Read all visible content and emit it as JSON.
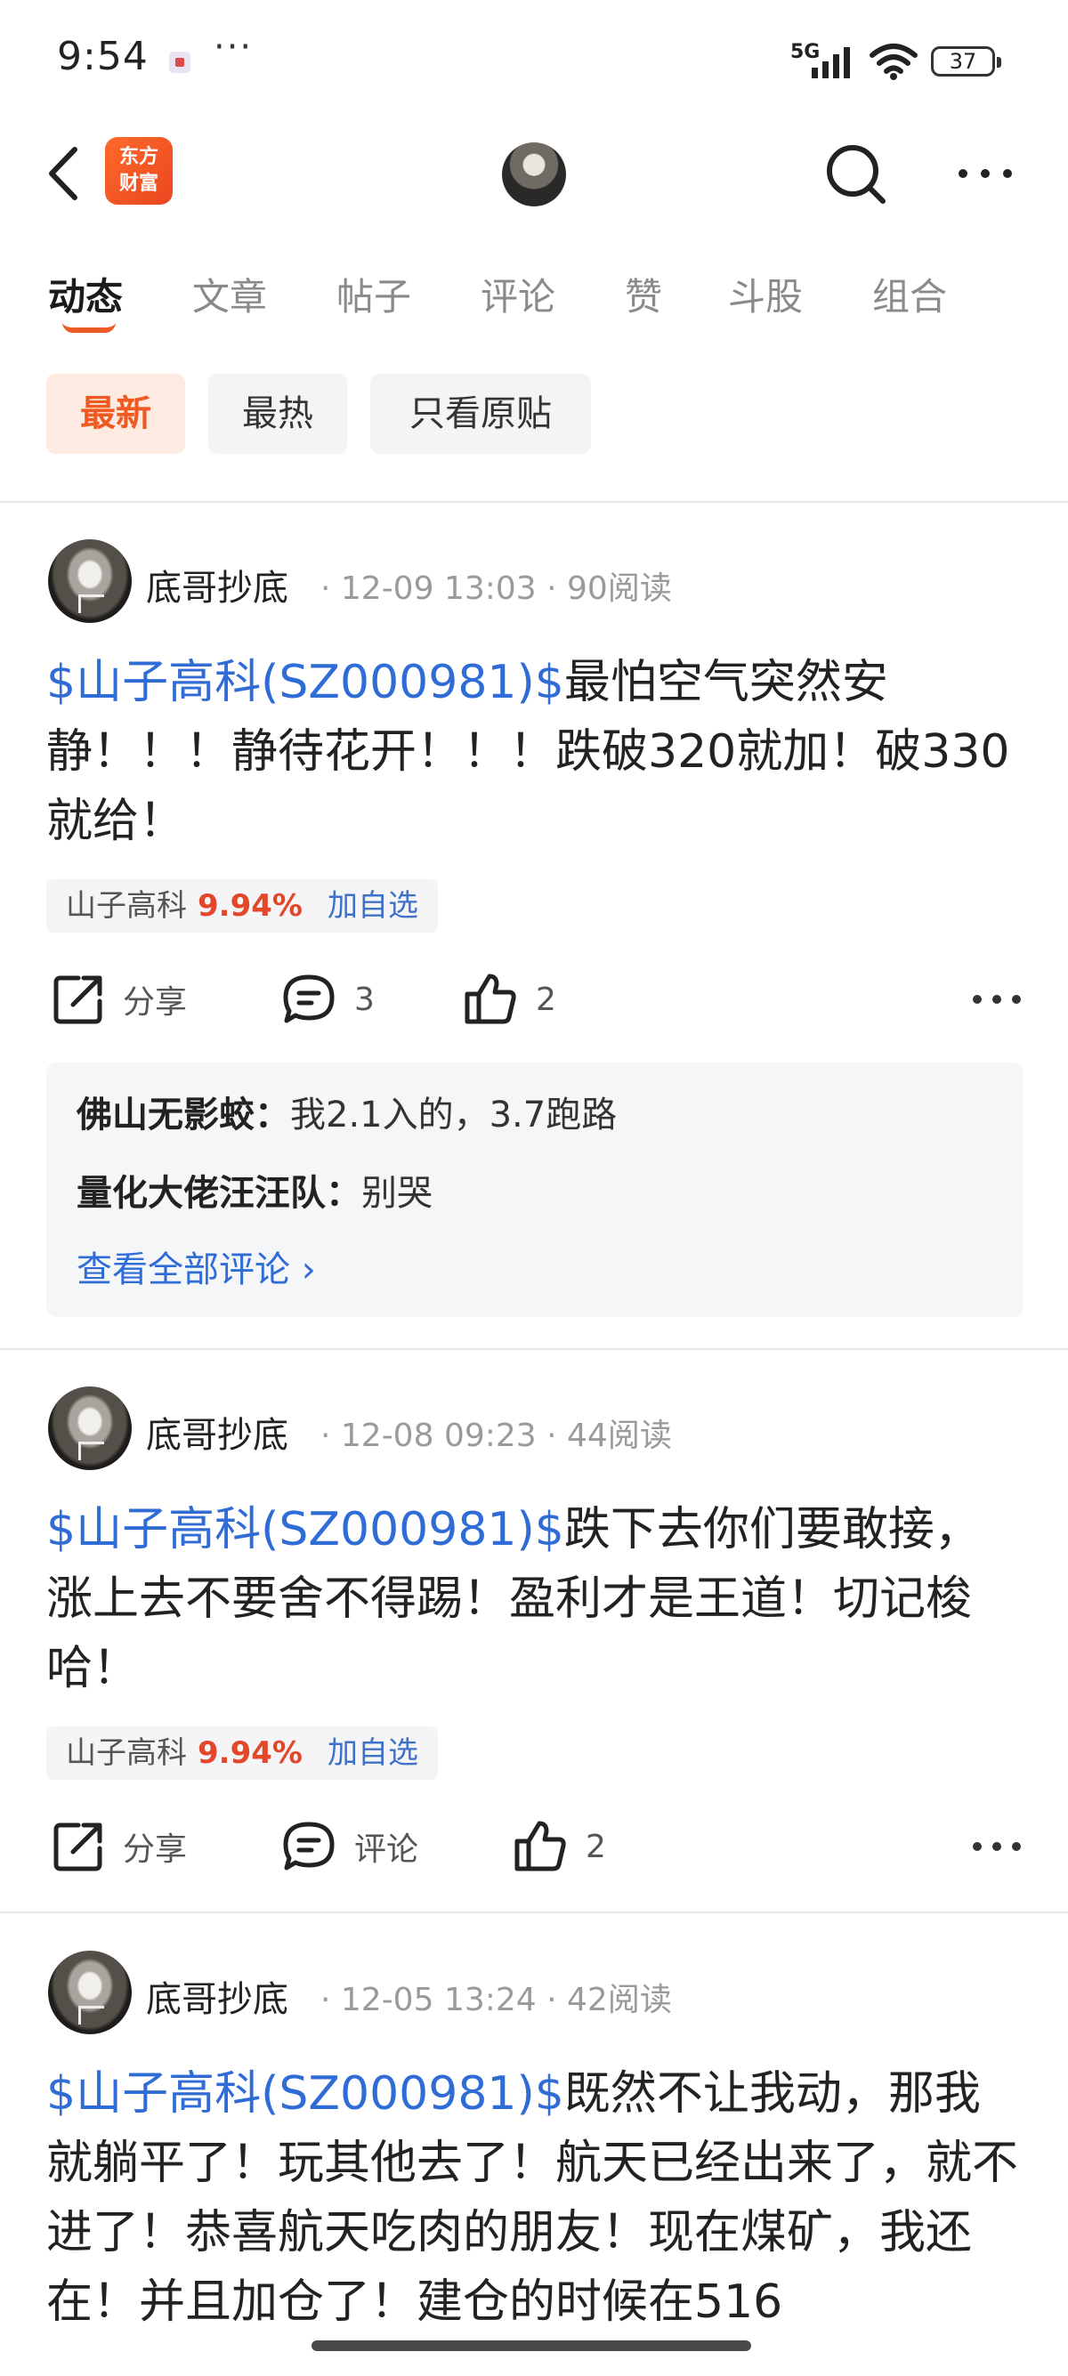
{
  "status_bar": {
    "time": "9:54",
    "dots": "···",
    "network": "5G",
    "battery": "37"
  },
  "nav": {
    "brand": "东方财富",
    "brand_line1": "东方",
    "brand_line2": "财富"
  },
  "tabs": [
    {
      "label": "动态",
      "active": true
    },
    {
      "label": "文章"
    },
    {
      "label": "帖子"
    },
    {
      "label": "评论"
    },
    {
      "label": "赞"
    },
    {
      "label": "斗股"
    },
    {
      "label": "组合"
    }
  ],
  "filters": [
    {
      "label": "最新",
      "active": true
    },
    {
      "label": "最热"
    },
    {
      "label": "只看原贴"
    }
  ],
  "posts": [
    {
      "author": "底哥抄底",
      "meta": "· 12-09 13:03 · 90阅读",
      "stock_link": "$山子高科(SZ000981)$",
      "text": "最怕空气突然安静！！！静待花开！！！跌破320就加！破330就给！",
      "tag": {
        "name": "山子高科",
        "pct": "9.94%",
        "add": "加自选"
      },
      "share": "分享",
      "comment": "3",
      "like": "2",
      "comments": [
        {
          "user": "佛山无影蛟：",
          "text": "我2.1入的，3.7跑路"
        },
        {
          "user": "量化大佬汪汪队：",
          "text": "别哭"
        }
      ],
      "view_all": "查看全部评论 ›"
    },
    {
      "author": "底哥抄底",
      "meta": "· 12-08 09:23 · 44阅读",
      "stock_link": "$山子高科(SZ000981)$",
      "text": "跌下去你们要敢接，涨上去不要舍不得踢！盈利才是王道！切记梭哈！",
      "tag": {
        "name": "山子高科",
        "pct": "9.94%",
        "add": "加自选"
      },
      "share": "分享",
      "comment": "评论",
      "like": "2"
    },
    {
      "author": "底哥抄底",
      "meta": "· 12-05 13:24 · 42阅读",
      "stock_link": "$山子高科(SZ000981)$",
      "text": "既然不让我动，那我就躺平了！玩其他去了！航天已经出来了，就不进了！恭喜航天吃肉的朋友！现在煤矿，我还在！并且加仓了！建仓的时候在516"
    }
  ]
}
